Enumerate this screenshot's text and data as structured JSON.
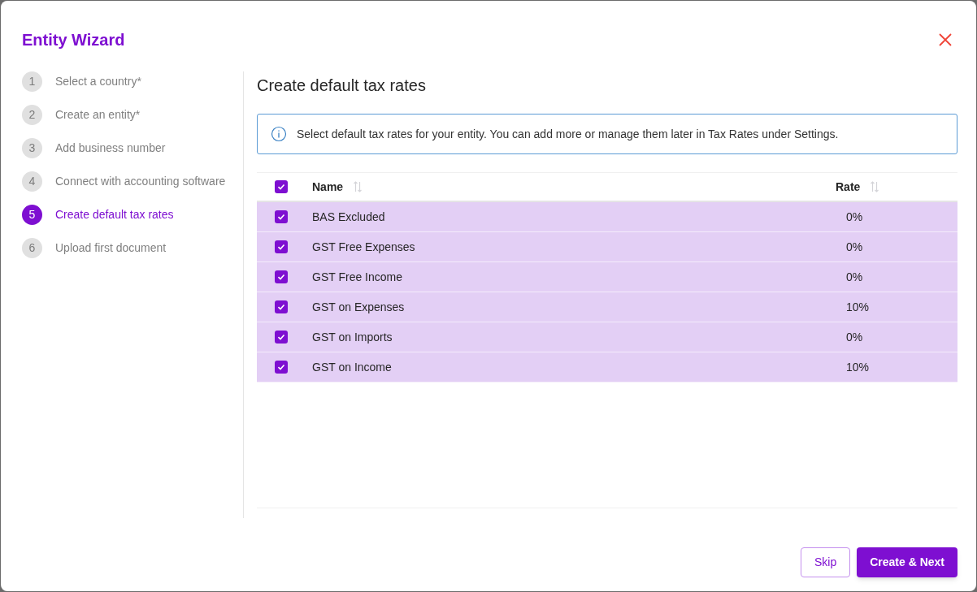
{
  "dialog": {
    "title": "Entity Wizard"
  },
  "steps": [
    {
      "number": "1",
      "label": "Select a country*",
      "selected": false
    },
    {
      "number": "2",
      "label": "Create an entity*",
      "selected": false
    },
    {
      "number": "3",
      "label": "Add business number",
      "selected": false
    },
    {
      "number": "4",
      "label": "Connect with accounting software",
      "selected": false
    },
    {
      "number": "5",
      "label": "Create default tax rates",
      "selected": true
    },
    {
      "number": "6",
      "label": "Upload first document",
      "selected": false
    }
  ],
  "content": {
    "heading": "Create default tax rates",
    "info": "Select default tax rates for your entity. You can add more or manage them later in Tax Rates under Settings."
  },
  "table": {
    "select_all_checked": true,
    "columns": [
      "Name",
      "Rate"
    ],
    "rows": [
      {
        "name": "BAS Excluded",
        "rate": "0%",
        "checked": true
      },
      {
        "name": "GST Free Expenses",
        "rate": "0%",
        "checked": true
      },
      {
        "name": "GST Free Income",
        "rate": "0%",
        "checked": true
      },
      {
        "name": "GST on Expenses",
        "rate": "10%",
        "checked": true
      },
      {
        "name": "GST on Imports",
        "rate": "0%",
        "checked": true
      },
      {
        "name": "GST on Income",
        "rate": "10%",
        "checked": true
      }
    ]
  },
  "buttons": {
    "secondary": "Skip",
    "primary": "Create & Next"
  }
}
